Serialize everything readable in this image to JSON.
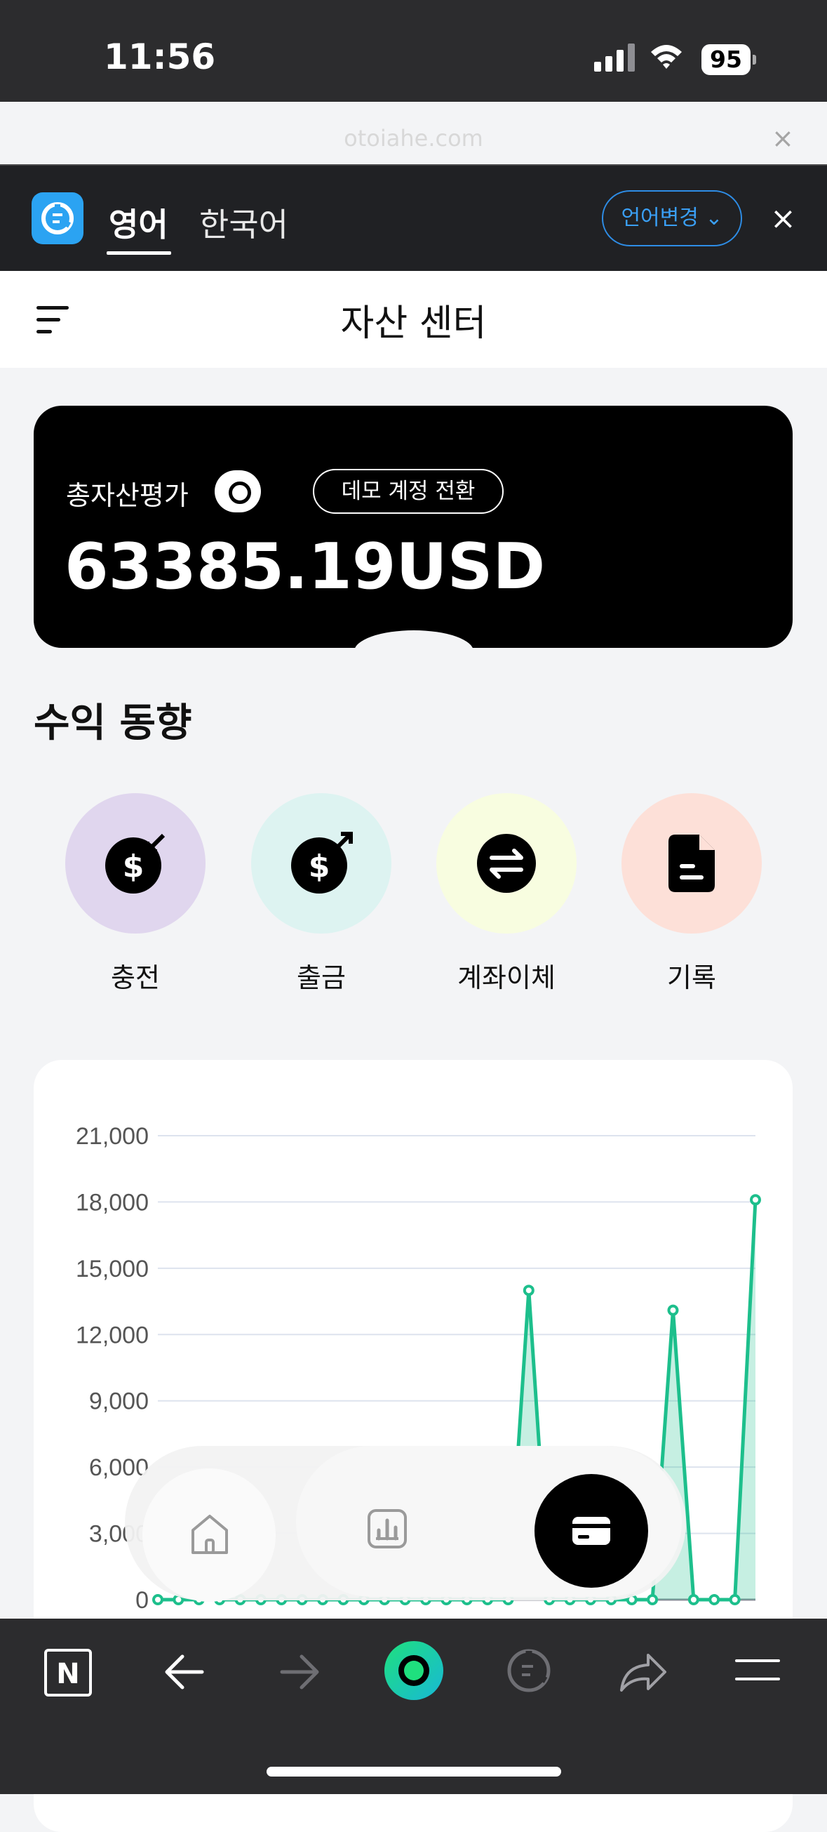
{
  "status_bar": {
    "time": "11:56",
    "battery": "95"
  },
  "browser": {
    "url": "otoiahe.com",
    "close": "×"
  },
  "translate_bar": {
    "lang_source": "영어",
    "lang_target": "한국어",
    "change_button": "언어변경 ⌄",
    "close": "×"
  },
  "header": {
    "title": "자산 센터"
  },
  "balance": {
    "label": "총자산평가",
    "demo_button": "데모 계정 전환",
    "amount": "63385.19USD"
  },
  "section": {
    "title": "수익 동향"
  },
  "actions": [
    {
      "label": "충전",
      "color": "#e0d6ee",
      "icon": "deposit-icon"
    },
    {
      "label": "출금",
      "color": "#ddf3f1",
      "icon": "withdraw-icon"
    },
    {
      "label": "계좌이체",
      "color": "#f8fde0",
      "icon": "transfer-icon"
    },
    {
      "label": "기록",
      "color": "#fde0d8",
      "icon": "record-icon"
    }
  ],
  "chart_data": {
    "type": "line",
    "series": [
      {
        "values": [
          0,
          0,
          0,
          0,
          0,
          0,
          0,
          0,
          0,
          0,
          0,
          0,
          0,
          0,
          0,
          0,
          0,
          0,
          14000,
          0,
          0,
          0,
          0,
          0,
          0,
          13100,
          0,
          0,
          0,
          18100
        ]
      }
    ],
    "yticks": [
      "21,000",
      "18,000",
      "15,000",
      "12,000",
      "9,000",
      "6,000",
      "3,000",
      "0"
    ],
    "ylim": [
      0,
      21000
    ],
    "color": "#1dbf8c",
    "grid": true
  },
  "nav": {
    "items": [
      "home-icon",
      "chart-icon",
      "wallet-icon"
    ]
  }
}
